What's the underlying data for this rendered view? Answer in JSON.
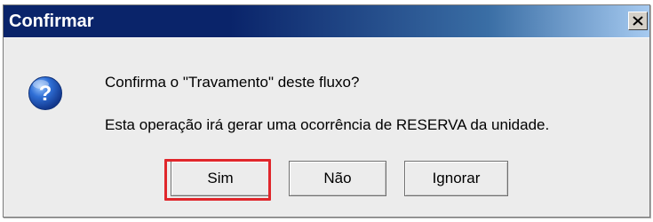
{
  "dialog": {
    "title": "Confirmar",
    "close_icon": "close-icon",
    "icon": "question-icon",
    "message_line1": "Confirma o \"Travamento\" deste fluxo?",
    "message_line2": "Esta operação irá gerar uma ocorrência de RESERVA da unidade.",
    "buttons": {
      "yes_label": "Sim",
      "no_label": "Não",
      "ignore_label": "Ignorar"
    },
    "highlight_color": "#e0262b",
    "titlebar_color": "#0a246a"
  }
}
